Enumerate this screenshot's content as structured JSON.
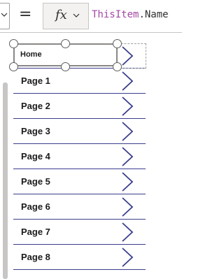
{
  "formula_bar": {
    "equals": "=",
    "fx_label": "fx",
    "formula_object": "ThisItem",
    "formula_dot": ".",
    "formula_property": "Name"
  },
  "gallery": {
    "items": [
      {
        "label": "Home"
      },
      {
        "label": "Page 1"
      },
      {
        "label": "Page 2"
      },
      {
        "label": "Page 3"
      },
      {
        "label": "Page 4"
      },
      {
        "label": "Page 5"
      },
      {
        "label": "Page 6"
      },
      {
        "label": "Page 7"
      },
      {
        "label": "Page 8"
      }
    ]
  },
  "icons": {
    "row_chevron": "chevron-right-icon",
    "dropdown": "chevron-down-icon"
  },
  "colors": {
    "chevron": "#3a3e8c",
    "formula_object": "#a347a3",
    "separator": "#3a3e8c"
  }
}
